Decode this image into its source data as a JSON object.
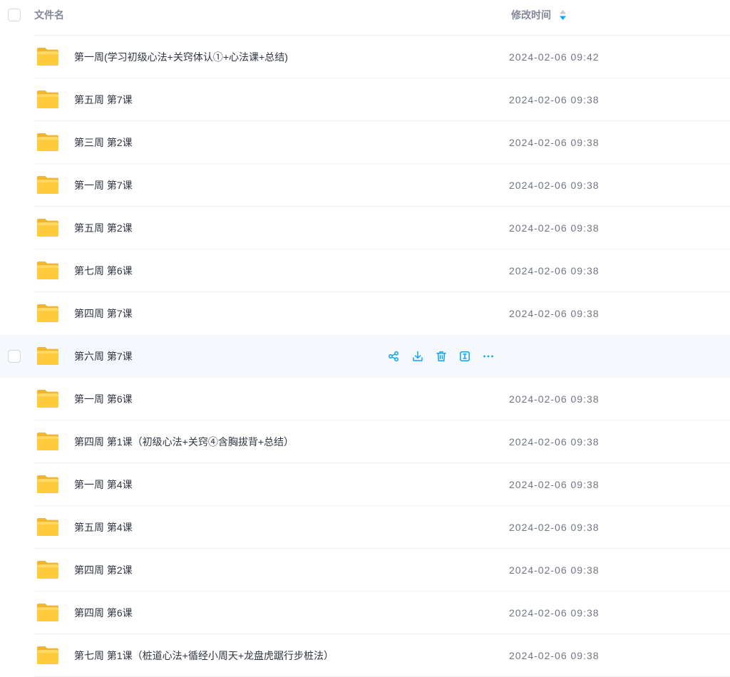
{
  "header": {
    "name_label": "文件名",
    "modified_label": "修改时间",
    "sort_icon": "sort-descending-icon"
  },
  "row_actions": [
    "share-icon",
    "download-icon",
    "trash-icon",
    "rename-icon",
    "more-icon"
  ],
  "files": [
    {
      "name": "第一周(学习初级心法+关窍体认①+心法课+总结)",
      "icon": "folder-icon",
      "modified": "2024-02-06 09:42"
    },
    {
      "name": "第五周 第7课",
      "icon": "folder-icon",
      "modified": "2024-02-06 09:38"
    },
    {
      "name": "第三周 第2课",
      "icon": "folder-icon",
      "modified": "2024-02-06 09:38"
    },
    {
      "name": "第一周 第7课",
      "icon": "folder-icon",
      "modified": "2024-02-06 09:38"
    },
    {
      "name": "第五周 第2课",
      "icon": "folder-icon",
      "modified": "2024-02-06 09:38"
    },
    {
      "name": "第七周 第6课",
      "icon": "folder-icon",
      "modified": "2024-02-06 09:38"
    },
    {
      "name": "第四周 第7课",
      "icon": "folder-icon",
      "modified": "2024-02-06 09:38"
    },
    {
      "name": "第六周 第7课",
      "icon": "folder-icon",
      "hovered": true
    },
    {
      "name": "第一周 第6课",
      "icon": "folder-icon",
      "modified": "2024-02-06 09:38"
    },
    {
      "name": "第四周 第1课（初级心法+关窍④含胸拔背+总结）",
      "icon": "folder-icon",
      "modified": "2024-02-06 09:38"
    },
    {
      "name": "第一周 第4课",
      "icon": "folder-icon",
      "modified": "2024-02-06 09:38"
    },
    {
      "name": "第五周 第4课",
      "icon": "folder-icon",
      "modified": "2024-02-06 09:38"
    },
    {
      "name": "第四周 第2课",
      "icon": "folder-icon",
      "modified": "2024-02-06 09:38"
    },
    {
      "name": "第四周 第6课",
      "icon": "folder-icon",
      "modified": "2024-02-06 09:38"
    },
    {
      "name": "第七周 第1课（桩道心法+循经小周天+龙盘虎踞行步桩法）",
      "icon": "folder-icon",
      "modified": "2024-02-06 09:38"
    }
  ],
  "colors": {
    "accent": "#06a7ff",
    "hover_background": "#f5f8fc",
    "folder": "#ffcb3d"
  }
}
